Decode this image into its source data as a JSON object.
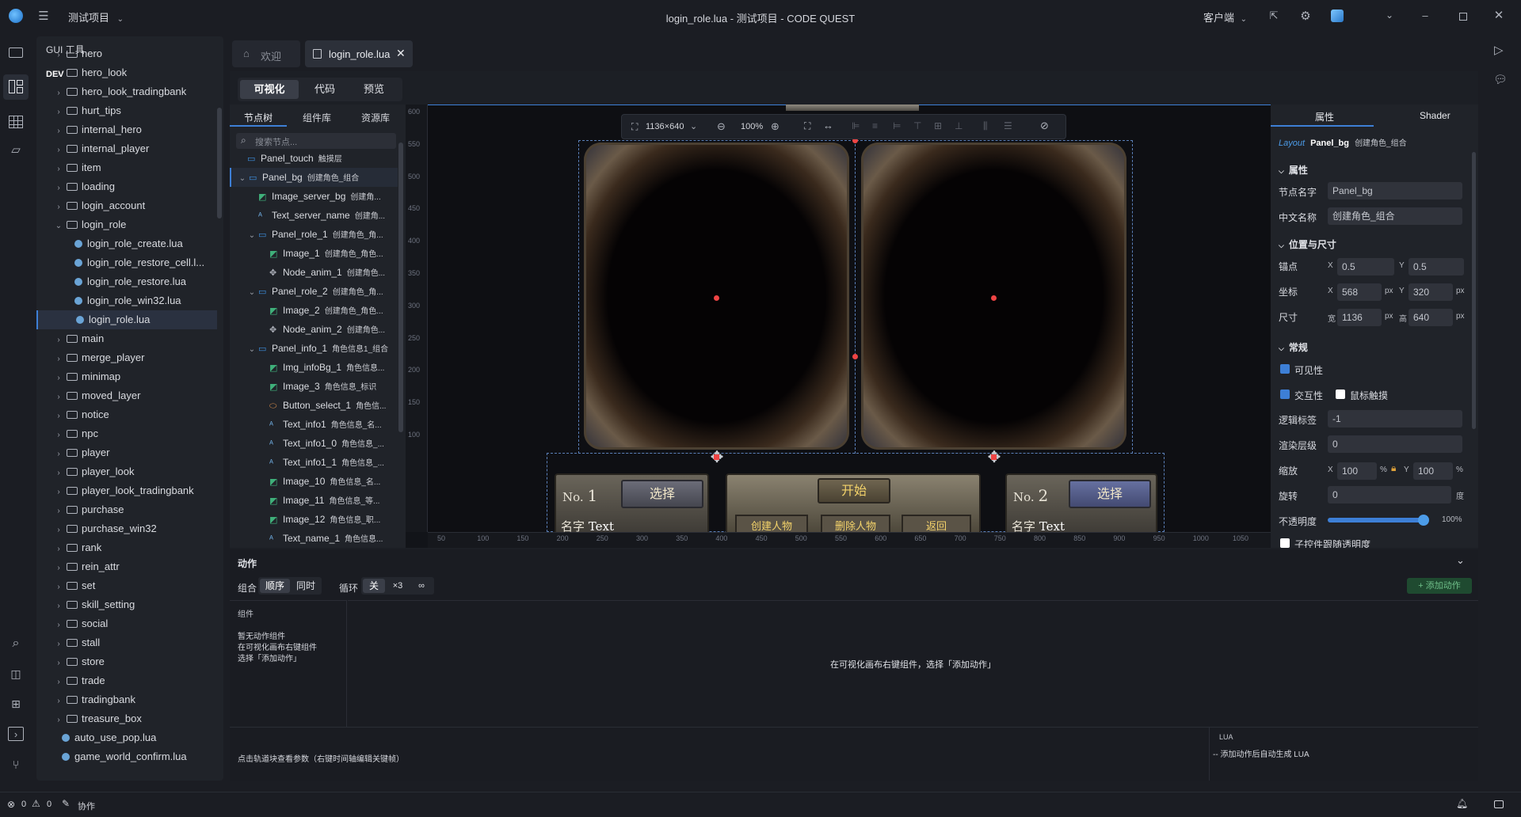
{
  "titlebar": {
    "project": "测试项目",
    "title": "login_role.lua - 测试项目 - CODE QUEST",
    "client_label": "客户端"
  },
  "explorer": {
    "title": "GUI 工具",
    "dev_label": "DEV",
    "items": [
      {
        "label": "hero",
        "type": "folder",
        "open": false,
        "depth": 0
      },
      {
        "label": "hero_look",
        "type": "folder",
        "open": false,
        "depth": 0
      },
      {
        "label": "hero_look_tradingbank",
        "type": "folder",
        "open": false,
        "depth": 0
      },
      {
        "label": "hurt_tips",
        "type": "folder",
        "open": false,
        "depth": 0
      },
      {
        "label": "internal_hero",
        "type": "folder",
        "open": false,
        "depth": 0
      },
      {
        "label": "internal_player",
        "type": "folder",
        "open": false,
        "depth": 0
      },
      {
        "label": "item",
        "type": "folder",
        "open": false,
        "depth": 0
      },
      {
        "label": "loading",
        "type": "folder",
        "open": false,
        "depth": 0
      },
      {
        "label": "login_account",
        "type": "folder",
        "open": false,
        "depth": 0
      },
      {
        "label": "login_role",
        "type": "folder",
        "open": true,
        "depth": 0
      },
      {
        "label": "login_role_create.lua",
        "type": "lua",
        "depth": 1
      },
      {
        "label": "login_role_restore_cell.l...",
        "type": "lua",
        "depth": 1
      },
      {
        "label": "login_role_restore.lua",
        "type": "lua",
        "depth": 1
      },
      {
        "label": "login_role_win32.lua",
        "type": "lua",
        "depth": 1
      },
      {
        "label": "login_role.lua",
        "type": "lua",
        "depth": 1,
        "selected": true
      },
      {
        "label": "main",
        "type": "folder",
        "open": false,
        "depth": 0
      },
      {
        "label": "merge_player",
        "type": "folder",
        "open": false,
        "depth": 0
      },
      {
        "label": "minimap",
        "type": "folder",
        "open": false,
        "depth": 0
      },
      {
        "label": "moved_layer",
        "type": "folder",
        "open": false,
        "depth": 0
      },
      {
        "label": "notice",
        "type": "folder",
        "open": false,
        "depth": 0
      },
      {
        "label": "npc",
        "type": "folder",
        "open": false,
        "depth": 0
      },
      {
        "label": "player",
        "type": "folder",
        "open": false,
        "depth": 0
      },
      {
        "label": "player_look",
        "type": "folder",
        "open": false,
        "depth": 0
      },
      {
        "label": "player_look_tradingbank",
        "type": "folder",
        "open": false,
        "depth": 0
      },
      {
        "label": "purchase",
        "type": "folder",
        "open": false,
        "depth": 0
      },
      {
        "label": "purchase_win32",
        "type": "folder",
        "open": false,
        "depth": 0
      },
      {
        "label": "rank",
        "type": "folder",
        "open": false,
        "depth": 0
      },
      {
        "label": "rein_attr",
        "type": "folder",
        "open": false,
        "depth": 0
      },
      {
        "label": "set",
        "type": "folder",
        "open": false,
        "depth": 0
      },
      {
        "label": "skill_setting",
        "type": "folder",
        "open": false,
        "depth": 0
      },
      {
        "label": "social",
        "type": "folder",
        "open": false,
        "depth": 0
      },
      {
        "label": "stall",
        "type": "folder",
        "open": false,
        "depth": 0
      },
      {
        "label": "store",
        "type": "folder",
        "open": false,
        "depth": 0
      },
      {
        "label": "trade",
        "type": "folder",
        "open": false,
        "depth": 0
      },
      {
        "label": "tradingbank",
        "type": "folder",
        "open": false,
        "depth": 0
      },
      {
        "label": "treasure_box",
        "type": "folder",
        "open": false,
        "depth": 0
      },
      {
        "label": "auto_use_pop.lua",
        "type": "lua",
        "depth": 0
      },
      {
        "label": "game_world_confirm.lua",
        "type": "lua",
        "depth": 0
      }
    ]
  },
  "tabs": [
    {
      "label": "欢迎",
      "active": false
    },
    {
      "label": "login_role.lua",
      "active": true
    }
  ],
  "view_modes": [
    "可视化",
    "代码",
    "预览"
  ],
  "left_tabs": [
    "节点树",
    "组件库",
    "资源库"
  ],
  "node_search_placeholder": "搜索节点...",
  "nodes": [
    {
      "name": "Panel_touch",
      "sub": "触摸层",
      "kind": "panel",
      "depth": 0,
      "expand": ""
    },
    {
      "name": "Panel_bg",
      "sub": "创建角色_组合",
      "kind": "panel",
      "depth": 0,
      "expand": "open",
      "selected": true
    },
    {
      "name": "Image_server_bg",
      "sub": "创建角...",
      "kind": "image",
      "depth": 1,
      "expand": ""
    },
    {
      "name": "Text_server_name",
      "sub": "创建角...",
      "kind": "text",
      "depth": 1,
      "expand": ""
    },
    {
      "name": "Panel_role_1",
      "sub": "创建角色_角...",
      "kind": "panel",
      "depth": 1,
      "expand": "open"
    },
    {
      "name": "Image_1",
      "sub": "创建角色_角色...",
      "kind": "image",
      "depth": 2,
      "expand": ""
    },
    {
      "name": "Node_anim_1",
      "sub": "创建角色...",
      "kind": "node",
      "depth": 2,
      "expand": ""
    },
    {
      "name": "Panel_role_2",
      "sub": "创建角色_角...",
      "kind": "panel",
      "depth": 1,
      "expand": "open"
    },
    {
      "name": "Image_2",
      "sub": "创建角色_角色...",
      "kind": "image",
      "depth": 2,
      "expand": ""
    },
    {
      "name": "Node_anim_2",
      "sub": "创建角色...",
      "kind": "node",
      "depth": 2,
      "expand": ""
    },
    {
      "name": "Panel_info_1",
      "sub": "角色信息1_组合",
      "kind": "panel",
      "depth": 1,
      "expand": "open"
    },
    {
      "name": "Img_infoBg_1",
      "sub": "角色信息...",
      "kind": "image",
      "depth": 2,
      "expand": ""
    },
    {
      "name": "Image_3",
      "sub": "角色信息_标识",
      "kind": "image",
      "depth": 2,
      "expand": ""
    },
    {
      "name": "Button_select_1",
      "sub": "角色信...",
      "kind": "button",
      "depth": 2,
      "expand": ""
    },
    {
      "name": "Text_info1",
      "sub": "角色信息_名...",
      "kind": "text",
      "depth": 2,
      "expand": ""
    },
    {
      "name": "Text_info1_0",
      "sub": "角色信息_...",
      "kind": "text",
      "depth": 2,
      "expand": ""
    },
    {
      "name": "Text_info1_1",
      "sub": "角色信息_...",
      "kind": "text",
      "depth": 2,
      "expand": ""
    },
    {
      "name": "Image_10",
      "sub": "角色信息_名...",
      "kind": "image",
      "depth": 2,
      "expand": ""
    },
    {
      "name": "Image_11",
      "sub": "角色信息_等...",
      "kind": "image",
      "depth": 2,
      "expand": ""
    },
    {
      "name": "Image_12",
      "sub": "角色信息_职...",
      "kind": "image",
      "depth": 2,
      "expand": ""
    },
    {
      "name": "Text_name_1",
      "sub": "角色信息...",
      "kind": "text",
      "depth": 2,
      "expand": ""
    }
  ],
  "canvas": {
    "size_label": "1136×640",
    "zoom": "100%",
    "ruler_x": [
      "50",
      "100",
      "150",
      "200",
      "250",
      "300",
      "350",
      "400",
      "450",
      "500",
      "550",
      "600",
      "650",
      "700",
      "750",
      "800",
      "850",
      "900",
      "950",
      "1000",
      "1050"
    ],
    "ruler_y": [
      "600",
      "550",
      "500",
      "450",
      "400",
      "350",
      "300",
      "250",
      "200",
      "150",
      "100"
    ],
    "game": {
      "no_label": "No.",
      "no1": "1",
      "no2": "2",
      "select": "选择",
      "start": "开始",
      "name_label": "名字",
      "text": "Text",
      "create_role": "创建人物",
      "delete_role": "删除人物",
      "back": "返回"
    }
  },
  "props": {
    "tabs": [
      "属性",
      "Shader"
    ],
    "layout_tag": "Layout",
    "node_name": "Panel_bg",
    "node_cn": "创建角色_组合",
    "sec_attr": "属性",
    "label_name": "节点名字",
    "value_name": "Panel_bg",
    "label_cn": "中文名称",
    "value_cn": "创建角色_组合",
    "sec_pos": "位置与尺寸",
    "label_anchor": "锚点",
    "anchor_x": "0.5",
    "anchor_y": "0.5",
    "label_coord": "坐标",
    "coord_x": "568",
    "coord_y": "320",
    "label_size": "尺寸",
    "size_w_label": "宽",
    "size_w": "1136",
    "size_h_label": "高",
    "size_h": "640",
    "x": "X",
    "y": "Y",
    "px": "px",
    "pct": "%",
    "deg": "度",
    "sec_common": "常规",
    "visible": "可见性",
    "interactive": "交互性",
    "swallow": "鼠标触摸",
    "label_tag": "逻辑标签",
    "value_tag": "-1",
    "label_zorder": "渲染层级",
    "value_zorder": "0",
    "label_scale": "缩放",
    "scale_x": "100",
    "scale_y": "100",
    "label_rotate": "旋转",
    "value_rotate": "0",
    "label_opacity": "不透明度",
    "opacity_value": "100%",
    "opacity_fraction": 1.0,
    "child_opacity": "子控件跟随透明度"
  },
  "action": {
    "title": "动作",
    "group_label": "组合",
    "seq": "顺序",
    "simul": "同时",
    "loop_label": "循环",
    "loop_off": "关",
    "loop_x3": "×3",
    "loop_inf": "∞",
    "add_action": "+ 添加动作",
    "component_header": "组件",
    "empty_lines": [
      "暂无动作组件",
      "在可视化画布右键组件",
      "选择「添加动作」"
    ],
    "center_hint": "在可视化画布右键组件，选择「添加动作」",
    "bottom_hint": "点击轨道块查看参数（右键时间轴编辑关键帧）",
    "lua_label": "LUA",
    "lua_hint": "-- 添加动作后自动生成 LUA"
  },
  "status": {
    "errors": "0",
    "warnings": "0",
    "collab": "协作"
  }
}
